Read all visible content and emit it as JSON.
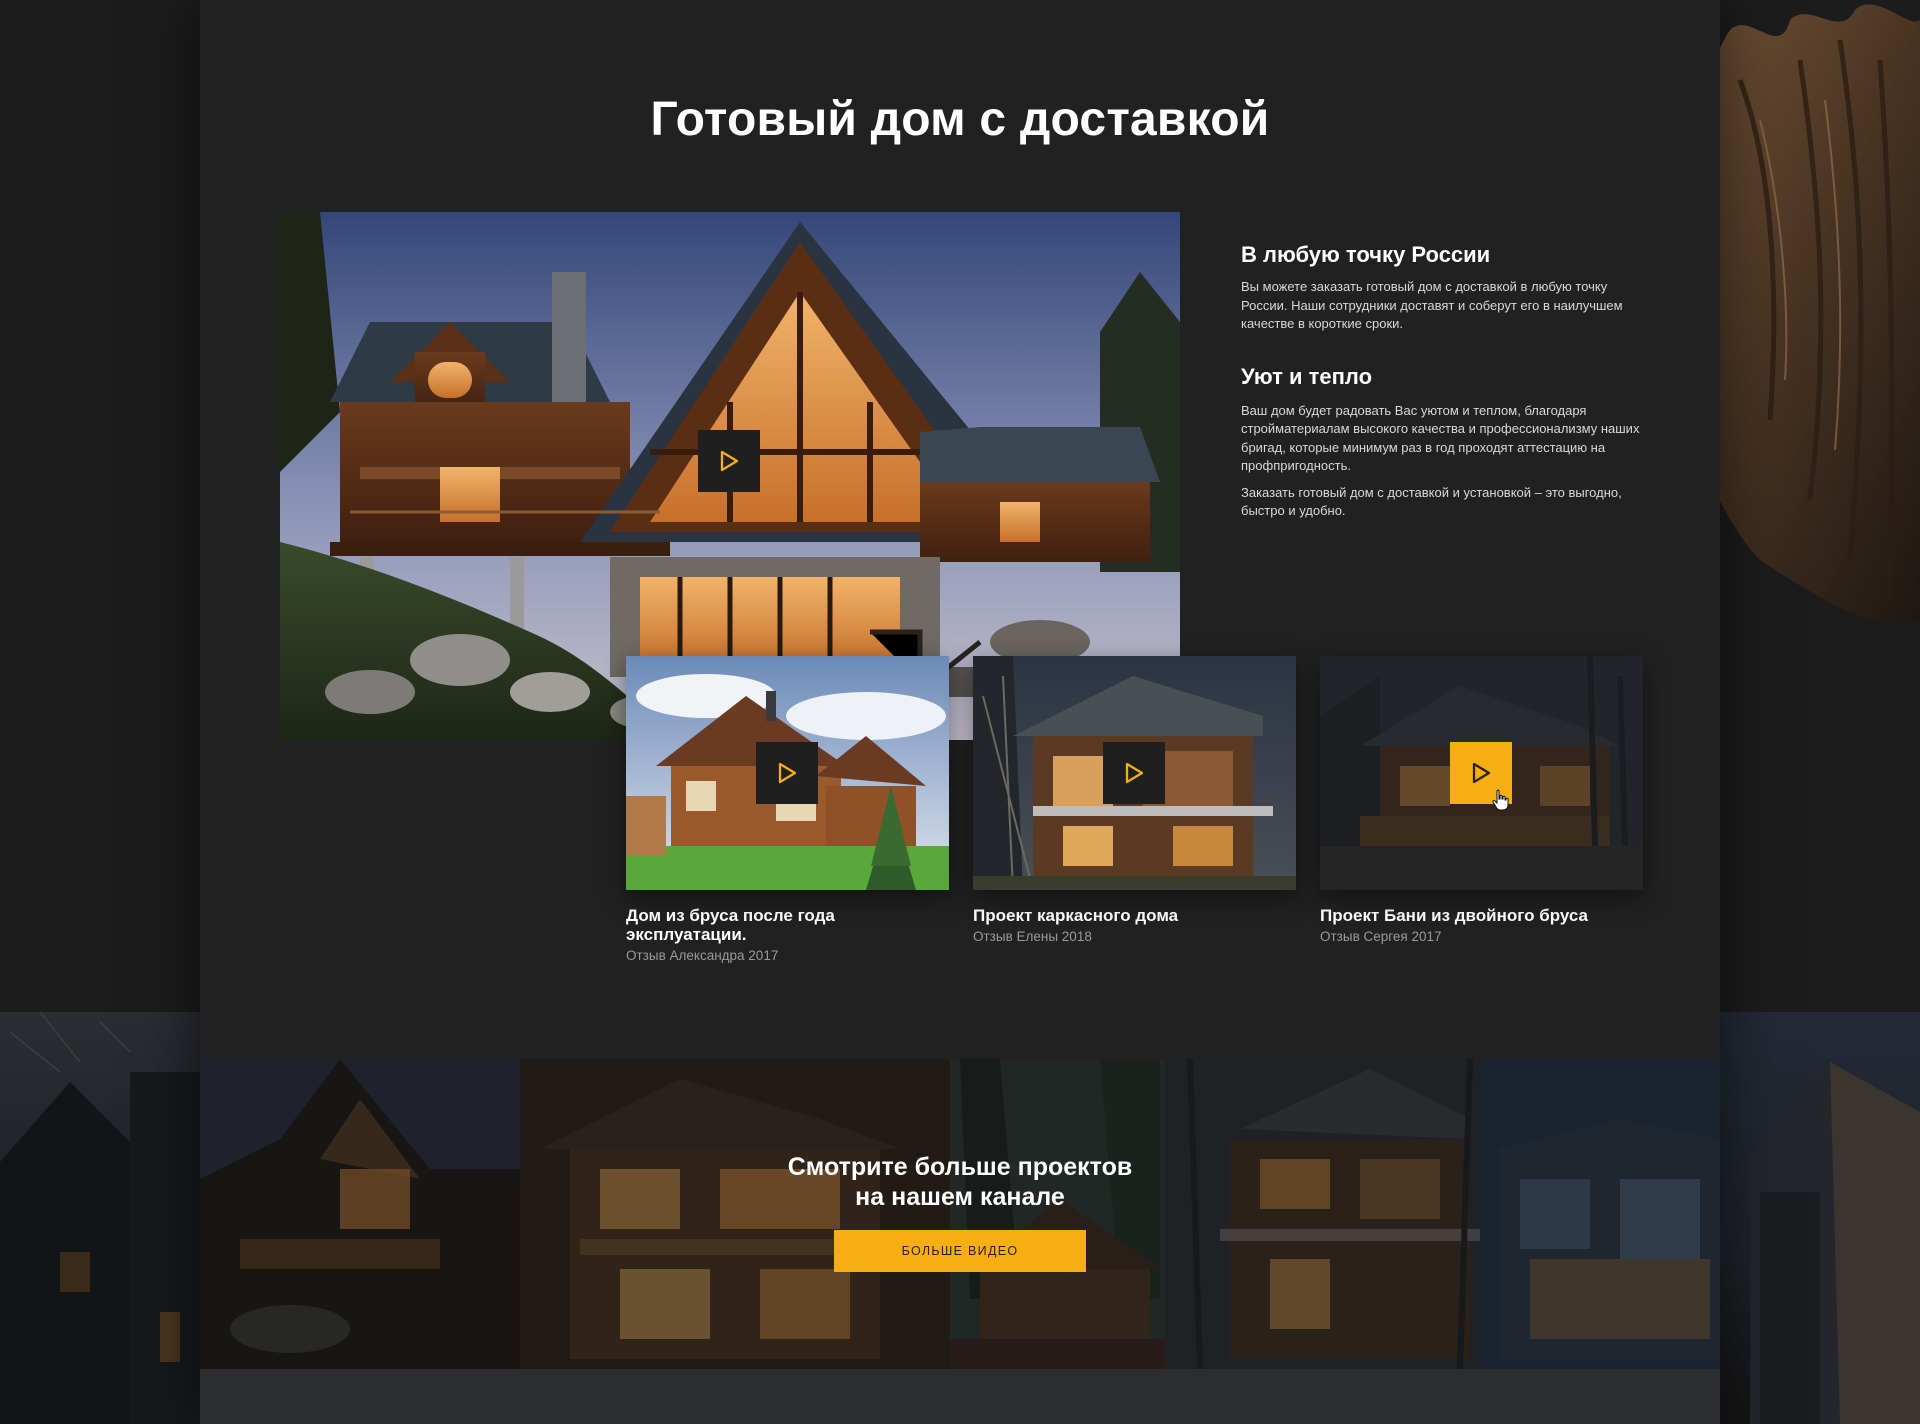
{
  "page": {
    "title": "Готовый дом с доставкой"
  },
  "info": {
    "block1": {
      "heading": "В любую точку России",
      "text": "Вы можете заказать готовый дом с доставкой в любую точку России. Наши сотрудники доставят и соберут его в наилучшем качестве в короткие сроки."
    },
    "block2": {
      "heading": "Уют и тепло",
      "text1": "Ваш дом будет радовать Вас уютом и теплом, благодаря стройматериалам высокого качества и профессионализму наших бригад, которые минимум раз в год проходят аттестацию на профпригодность.",
      "text2": "Заказать готовый дом с доставкой и установкой – это выгодно, быстро и удобно."
    }
  },
  "videos": [
    {
      "title": "Дом из бруса после года эксплуатации.",
      "subtitle": "Отзыв Александра 2017"
    },
    {
      "title": "Проект каркасного дома",
      "subtitle": "Отзыв Елены 2018"
    },
    {
      "title": "Проект Бани из двойного бруса",
      "subtitle": "Отзыв Сергея 2017"
    }
  ],
  "channel": {
    "title_line1": "Смотрите больше проектов",
    "title_line2": "на нашем канале",
    "button_label": "Больше видео"
  },
  "colors": {
    "accent": "#f7ae12",
    "panel": "#212121",
    "backdrop": "#1b1b1b"
  },
  "icons": [
    "play-icon",
    "hand-cursor-icon"
  ]
}
